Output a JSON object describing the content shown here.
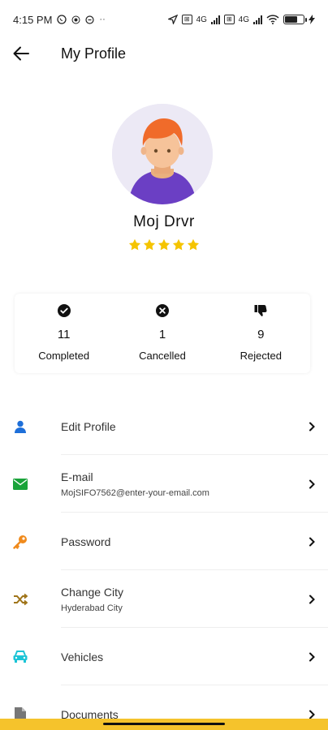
{
  "status_bar": {
    "time": "4:15 PM",
    "extra": "··",
    "net1": "4G",
    "net2": "4G"
  },
  "header": {
    "title": "My Profile",
    "back_icon": "arrow-left-icon"
  },
  "profile": {
    "name": "Moj Drvr",
    "rating": 5,
    "star_color": "#f5c400"
  },
  "stats": [
    {
      "icon": "check-circle-icon",
      "count": "11",
      "label": "Completed"
    },
    {
      "icon": "x-circle-icon",
      "count": "1",
      "label": "Cancelled"
    },
    {
      "icon": "thumbs-down-icon",
      "count": "9",
      "label": "Rejected"
    }
  ],
  "menu": [
    {
      "icon": "user-icon",
      "icon_color": "#1e6fd9",
      "label": "Edit Profile",
      "sub": ""
    },
    {
      "icon": "mail-icon",
      "icon_color": "#1aa33a",
      "label": "E-mail",
      "sub": "MojSIFO7562@enter-your-email.com"
    },
    {
      "icon": "key-icon",
      "icon_color": "#f08a1c",
      "label": "Password",
      "sub": ""
    },
    {
      "icon": "shuffle-icon",
      "icon_color": "#a0751a",
      "label": "Change City",
      "sub": "Hyderabad City"
    },
    {
      "icon": "car-icon",
      "icon_color": "#1cc4d6",
      "label": "Vehicles",
      "sub": ""
    },
    {
      "icon": "document-icon",
      "icon_color": "#777777",
      "label": "Documents",
      "sub": ""
    }
  ],
  "colors": {
    "accent_bottom": "#f5c32c"
  }
}
